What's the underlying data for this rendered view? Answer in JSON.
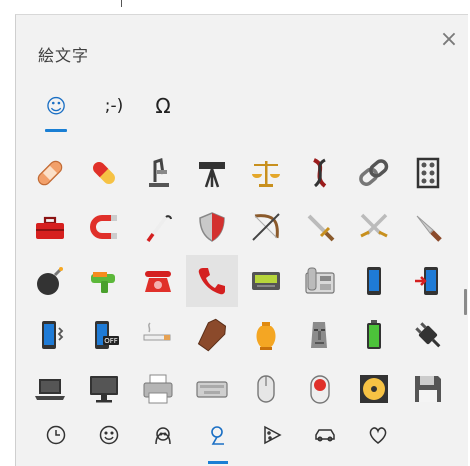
{
  "window": {
    "title": "絵文字",
    "close_label": "×"
  },
  "tabs": [
    {
      "label": "☺",
      "name": "emoji"
    },
    {
      "label": ";-)",
      "name": "kaomoji"
    },
    {
      "label": "Ω",
      "name": "symbols"
    }
  ],
  "emoji_grid": {
    "rows": [
      [
        "bandage",
        "pill",
        "microscope",
        "telescope",
        "scales",
        "dna",
        "link",
        "abacus"
      ],
      [
        "toolbox",
        "magnet",
        "cane",
        "shield",
        "bow-and-arrow",
        "dagger",
        "crossed-swords",
        "knife"
      ],
      [
        "bomb",
        "water-pistol",
        "telephone",
        "telephone-receiver",
        "pager",
        "fax-machine",
        "mobile-phone",
        "mobile-phone-arrow"
      ],
      [
        "mobile-phone-vibration",
        "mobile-phone-off",
        "cigarette",
        "coffin",
        "funeral-urn",
        "moai",
        "battery",
        "electric-plug"
      ],
      [
        "laptop",
        "desktop-computer",
        "printer",
        "keyboard",
        "computer-mouse",
        "trackball",
        "optical-disc",
        "floppy-disk"
      ]
    ],
    "selected": "telephone-receiver",
    "off_badge": "OFF"
  },
  "categories": [
    {
      "name": "recent",
      "icon": "clock-icon"
    },
    {
      "name": "smileys",
      "icon": "smiley-icon"
    },
    {
      "name": "people",
      "icon": "person-icon"
    },
    {
      "name": "objects",
      "icon": "map-pin-icon"
    },
    {
      "name": "food",
      "icon": "pizza-icon"
    },
    {
      "name": "travel",
      "icon": "car-icon"
    },
    {
      "name": "symbols",
      "icon": "heart-icon"
    }
  ],
  "active_category": "objects",
  "colors": {
    "accent": "#1a7fd4",
    "selected_bg": "#e3e3e3",
    "panel_bg": "#f2f2f2"
  }
}
